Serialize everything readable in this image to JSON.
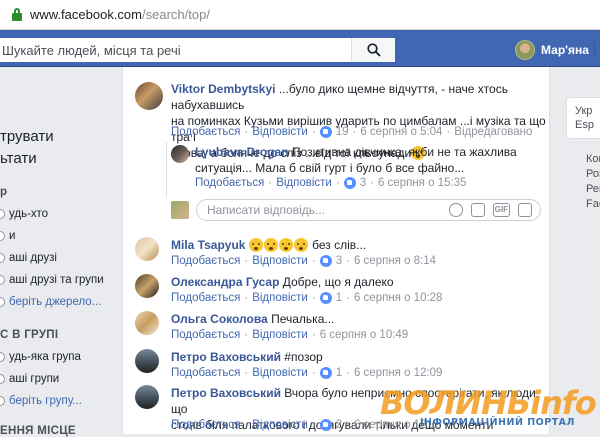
{
  "browser": {
    "url_domain": "www.facebook.com",
    "url_path": "/search/top/"
  },
  "header": {
    "search_placeholder": "Шукайте людей, місця та речі",
    "user_name": "Мар'яна"
  },
  "left": {
    "title_line1": "трувати",
    "title_line2": "ьтати",
    "letter": "р",
    "items": [
      "удь-хто",
      "и",
      "аші друзі",
      "аші друзі та групи",
      "беріть джерело..."
    ],
    "section": "С В ГРУПІ",
    "group_items": [
      "удь-яка група",
      "аші групи",
      "беріть групу..."
    ],
    "section2": "ЕННЯ МІСЦЕ"
  },
  "right": {
    "box_line1": "Укр",
    "box_line2": "Esp",
    "links": [
      "Кон",
      "Роз",
      "Рек",
      "Fac"
    ]
  },
  "comments": [
    {
      "author": "Viktor Dembytskyi",
      "text_line1": "...було дико щемне відчуття, - наче хтось набухавшись",
      "text_line2": "на поминках Кузьми вирішив ударить по цимбалам ...і музіка та що тра і",
      "text_line3": "слова, а боляче до сліз ...від тої кльоунади",
      "like": "Подобається",
      "reply": "Відповісти",
      "likes": "19",
      "time": "6 серпня о 5:04",
      "edited": "Відредаговано"
    },
    {
      "author": "Lyubava Drogan",
      "text_line1": "Позитивна дівчинка, якби не та жахлива",
      "text_line2": "ситуація... Мала б свій гурт і було б все файно...",
      "like": "Подобається",
      "reply": "Відповісти",
      "likes": "3",
      "time": "6 серпня о 15:35"
    },
    {
      "author": "Mila Tsapyuk",
      "text": "без слів...",
      "like": "Подобається",
      "reply": "Відповісти",
      "likes": "3",
      "time": "6 серпня о 8:14"
    },
    {
      "author": "Олександра Гусар",
      "text": "Добре, що я далеко",
      "like": "Подобається",
      "reply": "Відповісти",
      "likes": "1",
      "time": "6 серпня о 10:28"
    },
    {
      "author": "Ольга Соколова",
      "text": "Печалька...",
      "like": "Подобається",
      "reply": "Відповісти",
      "time": "6 серпня о 10:49"
    },
    {
      "author": "Петро Ваховський",
      "text": "#позор",
      "like": "Подобається",
      "reply": "Відповісти",
      "likes": "1",
      "time": "6 серпня о 12:09"
    },
    {
      "author": "Петро Ваховський",
      "text_line1": "Вчора було неприємно спостерігати, як люди, що",
      "text_line2": "стояв біля палаткового і дотягували тільки дещо моменти",
      "like": "Подобається",
      "reply": "Відповісти",
      "likes": "2",
      "time": "6 серпня о 12:..."
    }
  ],
  "reply_placeholder": "Написати відповідь...",
  "watermark": {
    "brand": "ВОЛИНЬinfo",
    "tagline": "ІНФОРМАЦІЙНИЙ ПОРТАЛ"
  },
  "colors": {
    "fb_blue": "#4267b2",
    "link": "#385898",
    "meta_gray": "#90949c"
  }
}
